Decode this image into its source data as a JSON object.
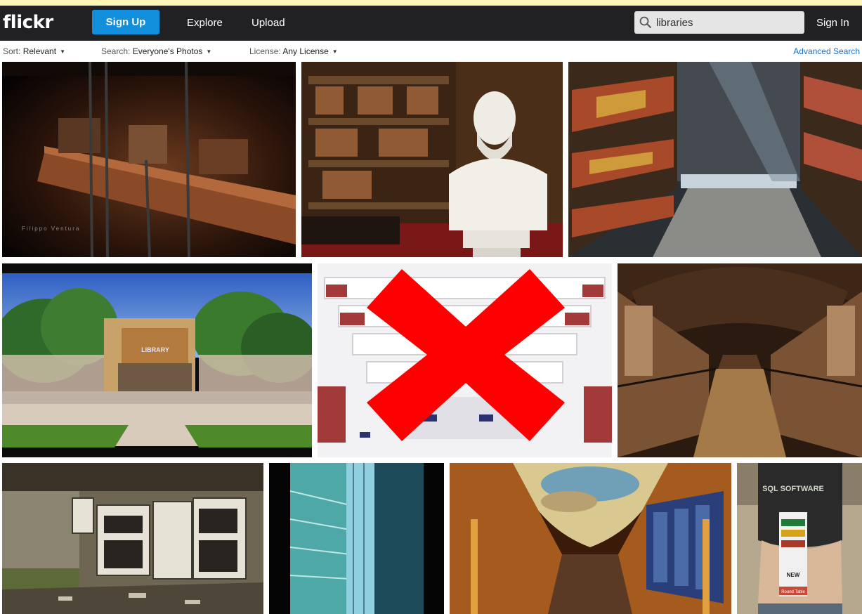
{
  "navbar": {
    "logo": "flickr",
    "signup_label": "Sign Up",
    "explore_label": "Explore",
    "upload_label": "Upload",
    "search_value": "libraries",
    "signin_label": "Sign In",
    "search_icon": "search-icon"
  },
  "filters": {
    "sort_label": "Sort:",
    "sort_value": "Relevant",
    "search_label": "Search:",
    "search_value": "Everyone's Photos",
    "license_label": "License:",
    "license_value": "Any License",
    "advanced_label": "Advanced Search"
  },
  "photos": {
    "p1_watermark": "Filippo Ventura",
    "p4_sign": "LIBRARY",
    "p10_shirt": "SQL SOFTWARE",
    "p10_lanyard_1": "NEW",
    "p10_lanyard_2": "Round Table"
  },
  "overlay": {
    "x_color": "#ff0000"
  },
  "colors": {
    "navbar_bg": "#212124",
    "accent": "#128fdc",
    "link": "#1a6fc4",
    "top_strip": "#fdf6b7"
  }
}
